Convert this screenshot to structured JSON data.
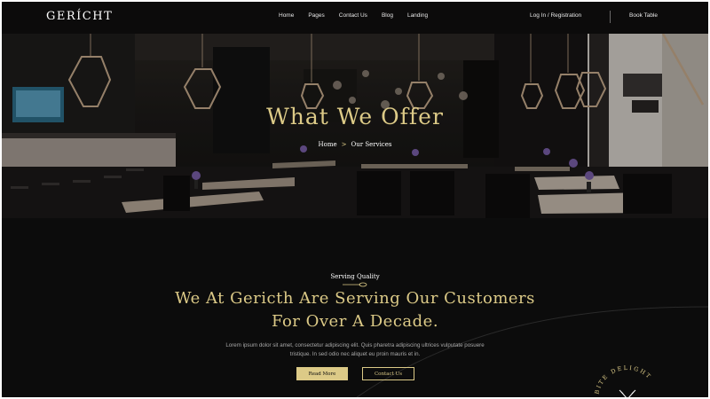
{
  "nav": {
    "logo": "GERÍCHT",
    "links": [
      "Home",
      "Pages",
      "Contact Us",
      "Blog",
      "Landing"
    ],
    "login": "Log In / Registration",
    "book": "Book Table"
  },
  "hero": {
    "title": "What We Offer",
    "breadcrumb_home": "Home",
    "breadcrumb_sep": ">",
    "breadcrumb_current": "Our Services"
  },
  "intro": {
    "subtitle": "Serving Quality",
    "heading_line1": "We At Gericth Are Serving Our Customers",
    "heading_line2": "For Over A Decade.",
    "paragraph_line1": "Lorem ipsum dolor sit amet, consectetur adipiscing elit. Quis pharetra adipiscing ultrices vulputate posuere",
    "paragraph_line2": "tristique. In sed odio nec aliquet eu proin mauris et in.",
    "read_more": "Read More",
    "contact": "Contact Us",
    "badge_text": "BITE DELIGHT"
  },
  "colors": {
    "gold": "#dcca87",
    "background": "#0c0c0c",
    "white": "#ffffff",
    "gray": "#a9a9a9"
  }
}
